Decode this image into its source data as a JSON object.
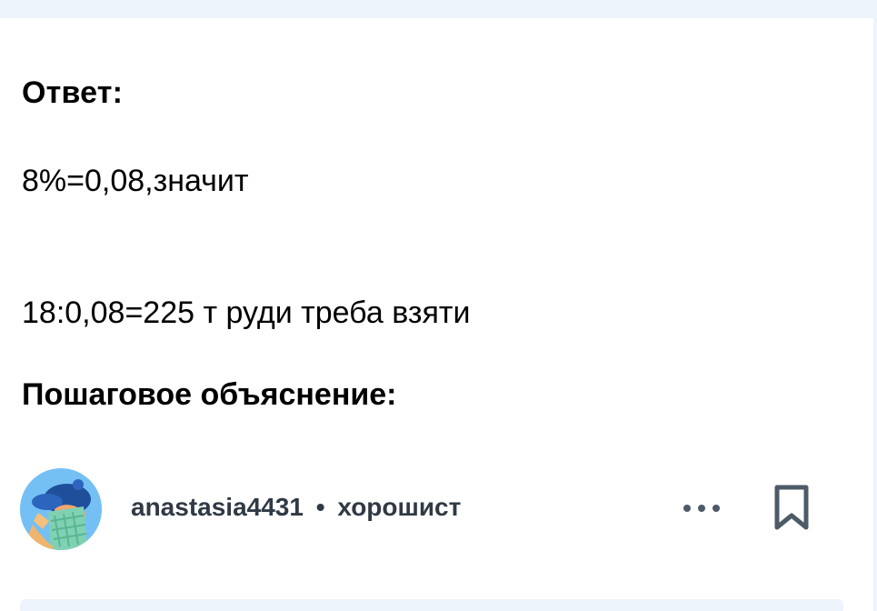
{
  "answer": {
    "label": "Ответ:",
    "lines": [
      "8%=0,08,значит",
      "18:0,08=225 т руди треба взяти"
    ]
  },
  "explanation": {
    "label": "Пошаговое объяснение:"
  },
  "author": {
    "username": "anastasia4431",
    "separator": "•",
    "rank": "хорошист",
    "avatar_icon": "student-avatar-icon"
  },
  "actions": {
    "more_icon": "more-horizontal-icon",
    "bookmark_icon": "bookmark-icon"
  },
  "colors": {
    "text": "#000000",
    "meta_text": "#2f3a45",
    "icon": "#4d5b68",
    "avatar_bg": "#74c0f4",
    "band_bg": "#eef4fb"
  }
}
